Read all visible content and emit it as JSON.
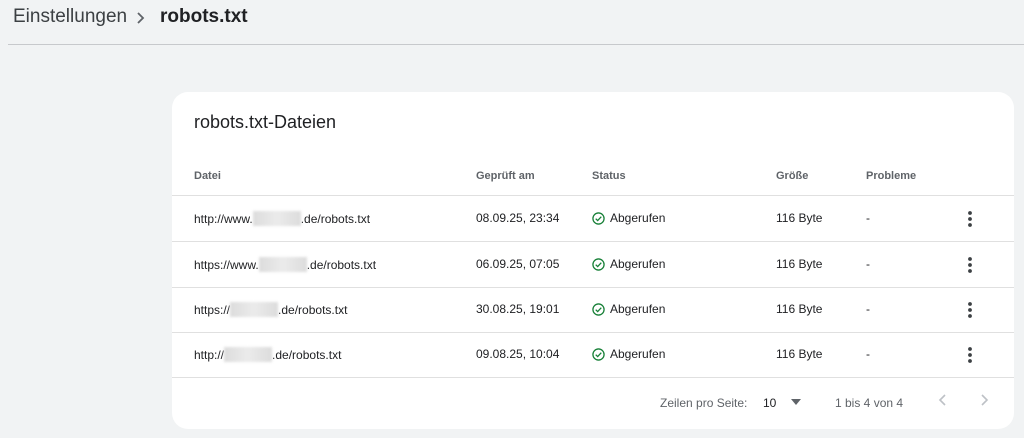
{
  "breadcrumb": {
    "parent": "Einstellungen",
    "current": "robots.txt"
  },
  "card": {
    "title": "robots.txt-Dateien",
    "columns": {
      "file": "Datei",
      "checked": "Geprüft am",
      "status": "Status",
      "size": "Größe",
      "problems": "Probleme"
    },
    "rows": [
      {
        "url_prefix": "http://www.",
        "url_suffix": ".de/robots.txt",
        "checked": "08.09.25, 23:34",
        "status": "Abgerufen",
        "size": "116 Byte",
        "problems": "-"
      },
      {
        "url_prefix": "https://www.",
        "url_suffix": ".de/robots.txt",
        "checked": "06.09.25, 07:05",
        "status": "Abgerufen",
        "size": "116 Byte",
        "problems": "-"
      },
      {
        "url_prefix": "https://",
        "url_suffix": ".de/robots.txt",
        "checked": "30.08.25, 19:01",
        "status": "Abgerufen",
        "size": "116 Byte",
        "problems": "-"
      },
      {
        "url_prefix": "http://",
        "url_suffix": ".de/robots.txt",
        "checked": "09.08.25, 10:04",
        "status": "Abgerufen",
        "size": "116 Byte",
        "problems": "-"
      }
    ]
  },
  "pagination": {
    "rows_per_page_label": "Zeilen pro Seite:",
    "rows_per_page_value": "10",
    "range": "1 bis 4 von 4"
  },
  "icons": {
    "separator": "chevron-right-icon",
    "status": "check-circle-icon",
    "row_menu": "more-vert-icon",
    "prev": "chevron-left-icon",
    "next": "chevron-right-icon"
  },
  "colors": {
    "background": "#f1f3f4",
    "status_green": "#188038"
  }
}
